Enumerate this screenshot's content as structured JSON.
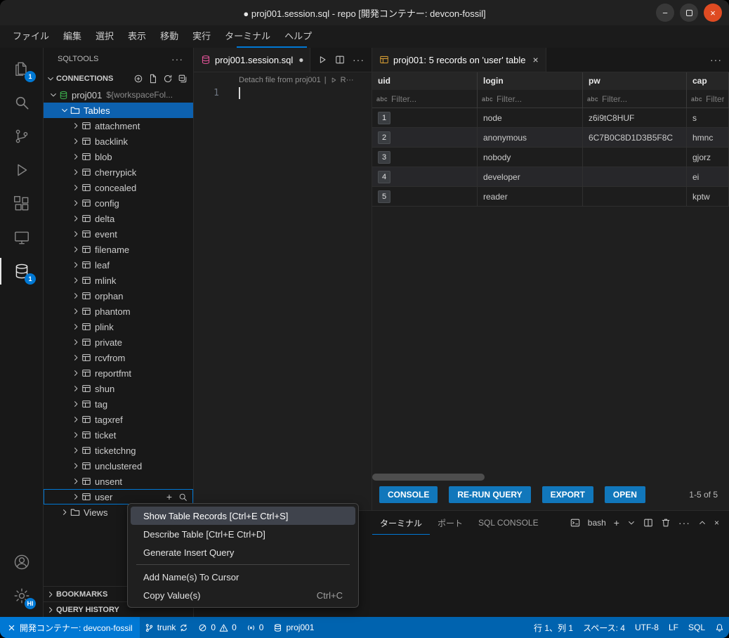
{
  "window": {
    "title": "● proj001.session.sql - repo [開発コンテナー: devcon-fossil]"
  },
  "icons": {
    "dirty": "●",
    "close": "×",
    "more": "···",
    "plus": "+",
    "minimize": "−"
  },
  "menu": {
    "items": [
      {
        "name": "file",
        "label": "ファイル"
      },
      {
        "name": "edit",
        "label": "編集"
      },
      {
        "name": "selection",
        "label": "選択"
      },
      {
        "name": "view",
        "label": "表示"
      },
      {
        "name": "go",
        "label": "移動"
      },
      {
        "name": "run",
        "label": "実行"
      },
      {
        "name": "terminal",
        "label": "ターミナル"
      },
      {
        "name": "help",
        "label": "ヘルプ"
      }
    ]
  },
  "activity": {
    "explorer_badge": "1",
    "database_badge": "1",
    "profile_badge": "HI"
  },
  "sidebar": {
    "title": "SQLTOOLS",
    "connections": "CONNECTIONS",
    "connection_name": "proj001",
    "connection_detail": "${workspaceFol...",
    "tables_label": "Tables",
    "views_label": "Views",
    "tables": [
      "attachment",
      "backlink",
      "blob",
      "cherrypick",
      "concealed",
      "config",
      "delta",
      "event",
      "filename",
      "leaf",
      "mlink",
      "orphan",
      "phantom",
      "plink",
      "private",
      "rcvfrom",
      "reportfmt",
      "shun",
      "tag",
      "tagxref",
      "ticket",
      "ticketchng",
      "unclustered",
      "unsent",
      "user"
    ],
    "bookmarks": "BOOKMARKS",
    "query_history": "QUERY HISTORY"
  },
  "editor": {
    "tab": "proj001.session.sql",
    "codelens_detach": "Detach file from proj001",
    "codelens_sep": "|",
    "codelens_run": "R···",
    "line1": "1"
  },
  "results": {
    "tab": "proj001: 5 records on 'user' table",
    "columns": [
      "uid",
      "login",
      "pw",
      "cap"
    ],
    "filter_placeholder": "Filter...",
    "rows": [
      [
        "1",
        "node",
        "z6i9tC8HUF",
        "s"
      ],
      [
        "2",
        "anonymous",
        "6C7B0C8D1D3B5F8C",
        "hmnc"
      ],
      [
        "3",
        "nobody",
        "",
        "gjorz"
      ],
      [
        "4",
        "developer",
        "",
        "ei"
      ],
      [
        "5",
        "reader",
        "",
        "kptw"
      ]
    ],
    "buttons": [
      {
        "name": "console",
        "label": "CONSOLE"
      },
      {
        "name": "re-run-query",
        "label": "RE-RUN QUERY"
      },
      {
        "name": "export",
        "label": "EXPORT"
      },
      {
        "name": "open",
        "label": "OPEN"
      }
    ],
    "pagination": "1-5 of 5"
  },
  "context_menu": {
    "items": [
      {
        "name": "show-table-records",
        "label": "Show Table Records [Ctrl+E Ctrl+S]",
        "highlighted": true
      },
      {
        "name": "describe-table",
        "label": "Describe Table [Ctrl+E Ctrl+D]"
      },
      {
        "name": "generate-insert-query",
        "label": "Generate Insert Query"
      },
      {
        "type": "separator"
      },
      {
        "name": "add-names-to-cursor",
        "label": "Add Name(s) To Cursor"
      },
      {
        "name": "copy-values",
        "label": "Copy Value(s)",
        "shortcut": "Ctrl+C"
      }
    ]
  },
  "panel": {
    "tabs": [
      {
        "name": "terminal",
        "label": "ターミナル",
        "active": true
      },
      {
        "name": "ports",
        "label": "ポート",
        "active": false
      },
      {
        "name": "sql-console",
        "label": "SQL CONSOLE",
        "active": false
      }
    ],
    "shell_label": "bash"
  },
  "statusbar": {
    "remote": "開発コンテナー: devcon-fossil",
    "branch": "trunk",
    "errors": "0",
    "warnings": "0",
    "ports": "0",
    "db": "proj001",
    "cursor": "行 1、列 1",
    "indent": "スペース: 4",
    "encoding": "UTF-8",
    "eol": "LF",
    "lang": "SQL"
  }
}
